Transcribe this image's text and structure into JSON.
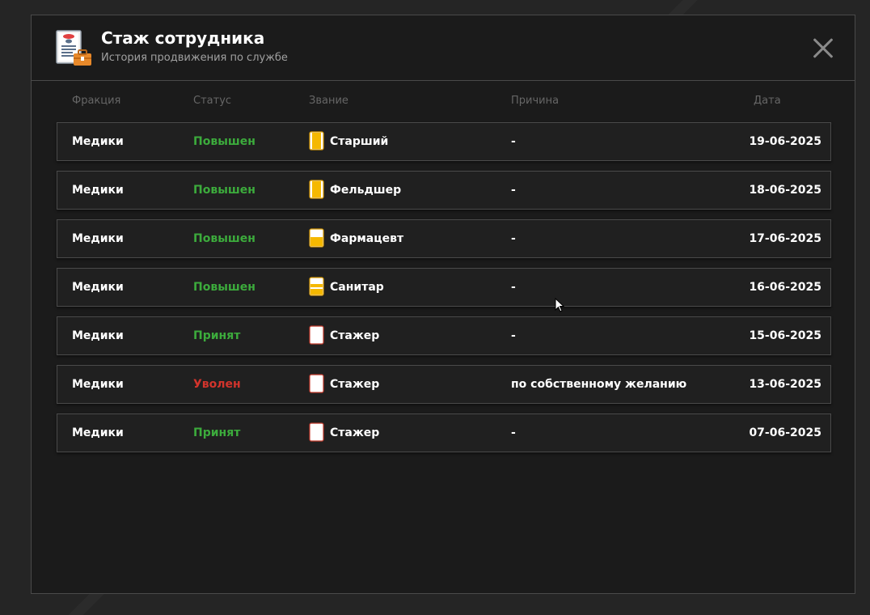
{
  "modal": {
    "title": "Стаж сотрудника",
    "subtitle": "История продвижения по службе"
  },
  "columns": {
    "faction": "Фракция",
    "status": "Статус",
    "rank": "Звание",
    "reason": "Причина",
    "date": "Дата"
  },
  "colors": {
    "promoted": "#3cab3c",
    "hired": "#3cab3c",
    "fired": "#d2342c",
    "rank_badge": "#f5b800"
  },
  "rows": [
    {
      "faction": "Медики",
      "status": "Повышен",
      "status_type": "promoted",
      "rank": "Старший",
      "rank_icon": "rank-badge-full-icon",
      "reason": "-",
      "date": "19-06-2025"
    },
    {
      "faction": "Медики",
      "status": "Повышен",
      "status_type": "promoted",
      "rank": "Фельдшер",
      "rank_icon": "rank-badge-full-icon",
      "reason": "-",
      "date": "18-06-2025"
    },
    {
      "faction": "Медики",
      "status": "Повышен",
      "status_type": "promoted",
      "rank": "Фармацевт",
      "rank_icon": "rank-badge-half-icon",
      "reason": "-",
      "date": "17-06-2025"
    },
    {
      "faction": "Медики",
      "status": "Повышен",
      "status_type": "promoted",
      "rank": "Санитар",
      "rank_icon": "rank-badge-stripes-icon",
      "reason": "-",
      "date": "16-06-2025"
    },
    {
      "faction": "Медики",
      "status": "Принят",
      "status_type": "hired",
      "rank": "Стажер",
      "rank_icon": "rank-badge-blank-icon",
      "reason": "-",
      "date": "15-06-2025"
    },
    {
      "faction": "Медики",
      "status": "Уволен",
      "status_type": "fired",
      "rank": "Стажер",
      "rank_icon": "rank-badge-blank-icon",
      "reason": "по собственному желанию",
      "date": "13-06-2025"
    },
    {
      "faction": "Медики",
      "status": "Принят",
      "status_type": "hired",
      "rank": "Стажер",
      "rank_icon": "rank-badge-blank-icon",
      "reason": "-",
      "date": "07-06-2025"
    }
  ],
  "icons": {
    "header": "employee-record-icon",
    "close": "close-icon",
    "cursor": "mouse-cursor-icon"
  }
}
